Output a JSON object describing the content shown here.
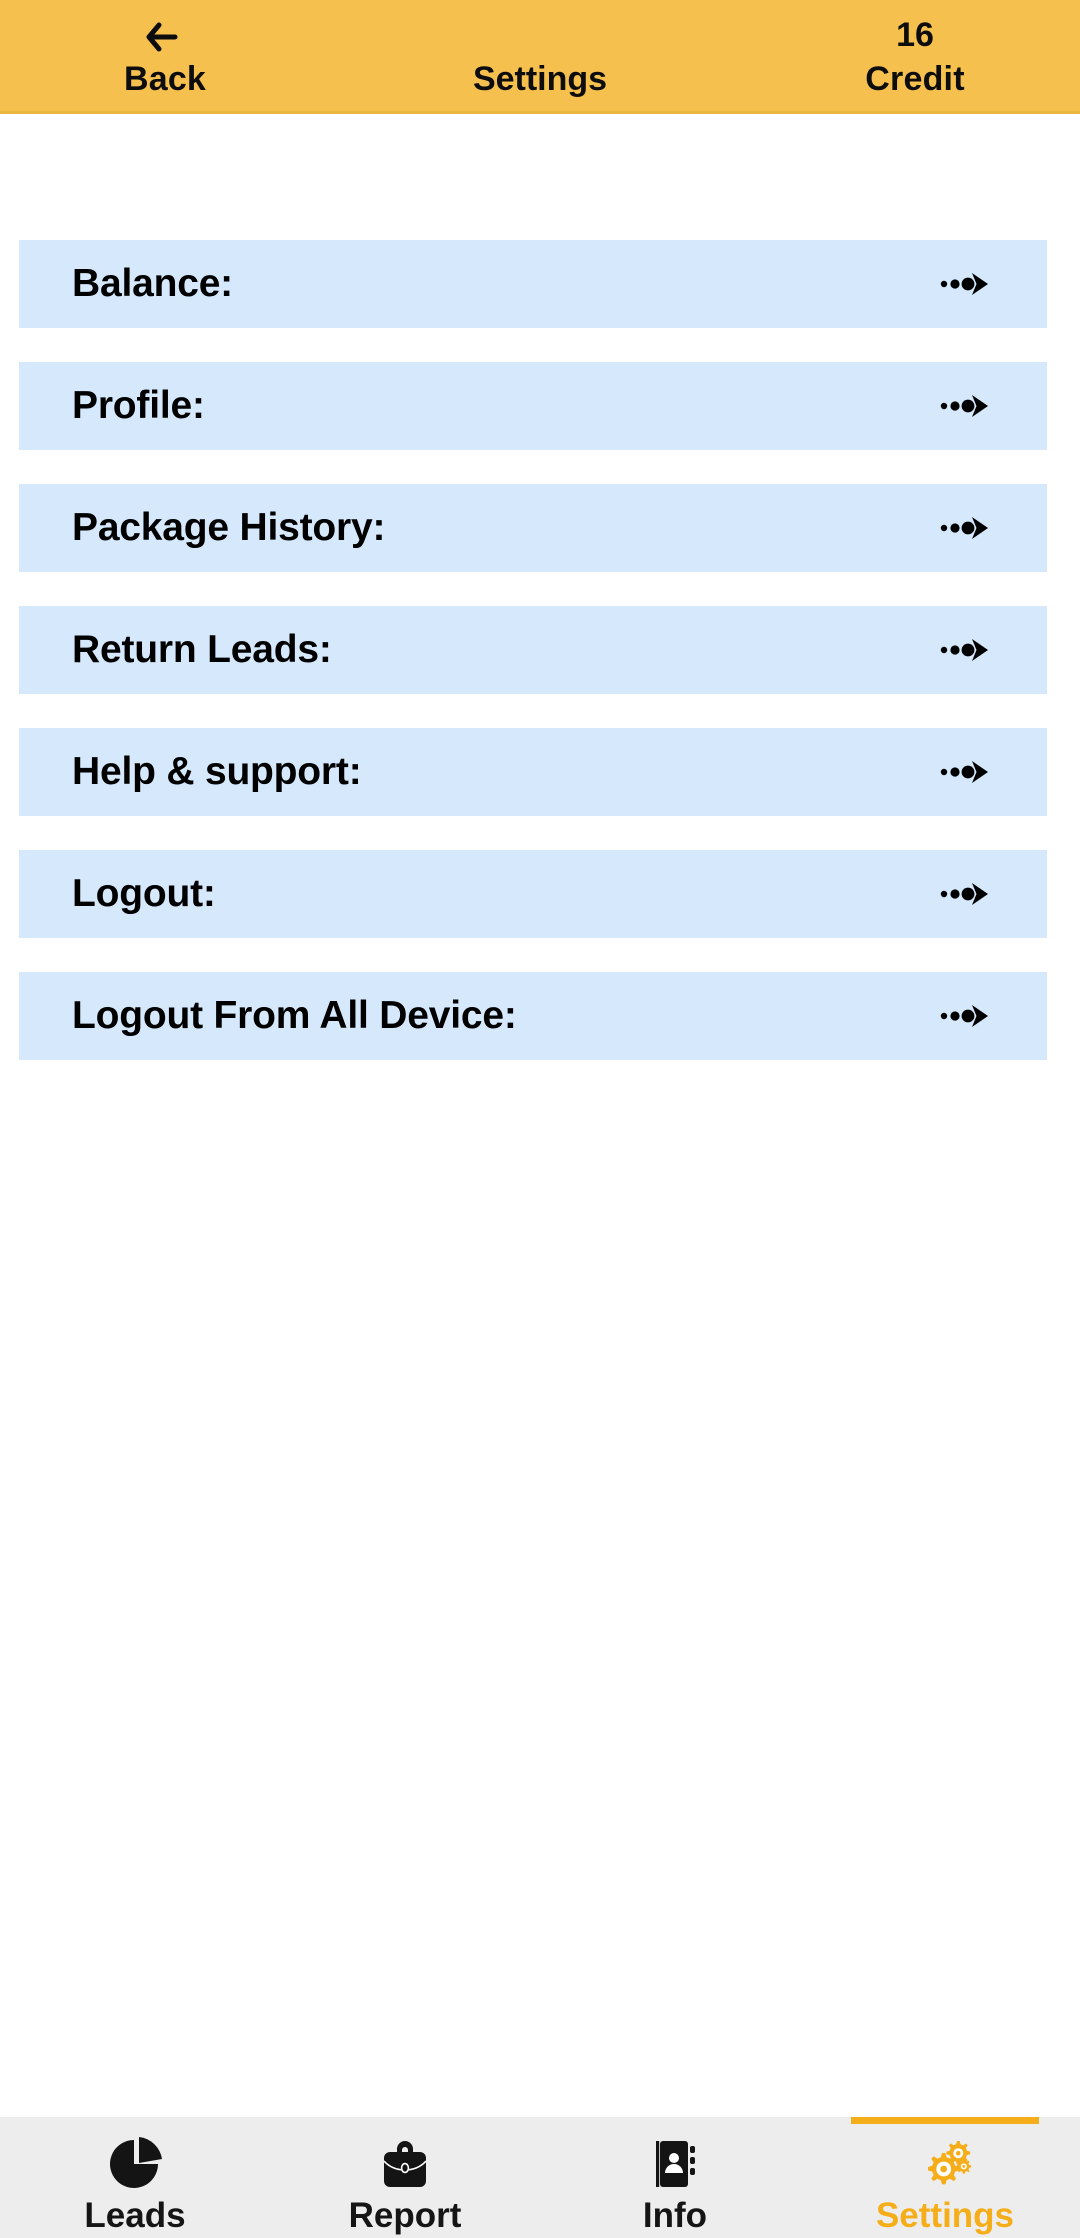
{
  "header": {
    "back_label": "Back",
    "back_icon": "arrow-left-icon",
    "title": "Settings",
    "credit_value": "16",
    "credit_label": "Credit",
    "bg_color": "#f5c04e",
    "text_color": "#0d0d0d"
  },
  "settings_list": {
    "row_bg_color": "#d5e8fc",
    "arrow_icon": "dotted-arrow-right-icon",
    "items": [
      {
        "label": "Balance:"
      },
      {
        "label": "Profile:"
      },
      {
        "label": "Package History:"
      },
      {
        "label": "Return Leads:"
      },
      {
        "label": "Help & support:"
      },
      {
        "label": "Logout:"
      },
      {
        "label": "Logout From All Device:"
      }
    ]
  },
  "bottom_nav": {
    "bg_color": "#ededed",
    "active_color": "#f5ae1a",
    "inactive_color": "#151515",
    "tabs": [
      {
        "label": "Leads",
        "icon": "pie-chart-icon",
        "active": false
      },
      {
        "label": "Report",
        "icon": "briefcase-icon",
        "active": false
      },
      {
        "label": "Info",
        "icon": "address-book-icon",
        "active": false
      },
      {
        "label": "Settings",
        "icon": "gears-icon",
        "active": true
      }
    ]
  }
}
